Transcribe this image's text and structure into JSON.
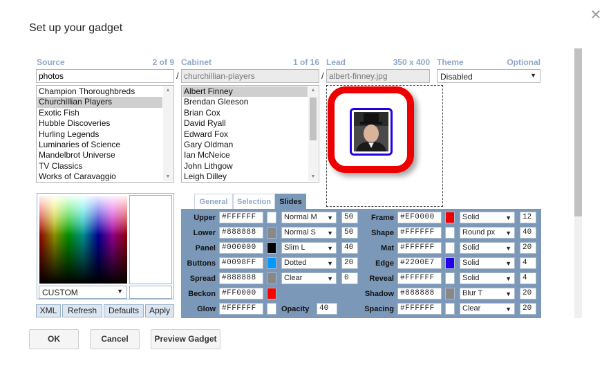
{
  "dialog": {
    "title": "Set up your gadget",
    "close_glyph": "✕"
  },
  "source": {
    "heading": "Source",
    "count": "2 of 9",
    "input_value": "photos",
    "items": [
      "Champion Thoroughbreds",
      "Churchillian Players",
      "Exotic Fish",
      "Hubble Discoveries",
      "Hurling Legends",
      "Luminaries of Science",
      "Mandelbrot Universe",
      "TV Classics",
      "Works of Caravaggio"
    ],
    "selected_index": 1
  },
  "cabinet": {
    "heading": "Cabinet",
    "count": "1 of 16",
    "input_value": "churchillian-players",
    "items": [
      "Albert Finney",
      "Brendan Gleeson",
      "Brian Cox",
      "David Ryall",
      "Edward Fox",
      "Gary Oldman",
      "Ian McNeice",
      "John Lithgow",
      "Leigh Dilley"
    ],
    "selected_index": 0
  },
  "lead": {
    "heading": "Lead",
    "size": "350 x 400",
    "input_value": "albert-finney.jpg"
  },
  "theme": {
    "heading": "Theme",
    "hint": "Optional",
    "selected": "Disabled"
  },
  "separators": {
    "slash": "/"
  },
  "color_picker": {
    "mode": "CUSTOM"
  },
  "action_buttons": {
    "xml": "XML",
    "refresh": "Refresh",
    "defaults": "Defaults",
    "apply": "Apply"
  },
  "tabs": [
    {
      "label": "General",
      "active": false
    },
    {
      "label": "Selection",
      "active": false
    },
    {
      "label": "Slides",
      "active": true
    }
  ],
  "settings_left": [
    {
      "label": "Upper",
      "hex": "#FFFFFF",
      "swatch": "#FFFFFF",
      "select": "Normal M",
      "num": "50"
    },
    {
      "label": "Lower",
      "hex": "#888888",
      "swatch": "#888888",
      "select": "Normal S",
      "num": "50"
    },
    {
      "label": "Panel",
      "hex": "#000000",
      "swatch": "#000000",
      "select": "Slim L",
      "num": "40"
    },
    {
      "label": "Buttons",
      "hex": "#0098FF",
      "swatch": "#0098FF",
      "select": "Dotted",
      "num": "20"
    },
    {
      "label": "Spread",
      "hex": "#888888",
      "swatch": "#888888",
      "select": "Clear",
      "num": "0"
    },
    {
      "label": "Beckon",
      "hex": "#FF0000",
      "swatch": "#FF0000"
    },
    {
      "label": "Glow",
      "hex": "#FFFFFF",
      "swatch": "#FFFFFF",
      "extra_label": "Opacity",
      "num": "40"
    }
  ],
  "settings_right": [
    {
      "label": "Frame",
      "hex": "#EF0000",
      "swatch": "#EF0000",
      "select": "Solid",
      "num": "12"
    },
    {
      "label": "Shape",
      "hex": "#FFFFFF",
      "swatch": "#FFFFFF",
      "select": "Round px",
      "num": "40"
    },
    {
      "label": "Mat",
      "hex": "#FFFFFF",
      "swatch": "#FFFFFF",
      "select": "Solid",
      "num": "20"
    },
    {
      "label": "Edge",
      "hex": "#2200E7",
      "swatch": "#2200E7",
      "select": "Solid",
      "num": "4"
    },
    {
      "label": "Reveal",
      "hex": "#FFFFFF",
      "swatch": "#FFFFFF",
      "select": "Solid",
      "num": "4"
    },
    {
      "label": "Shadow",
      "hex": "#888888",
      "swatch": "#888888",
      "select": "Blur T",
      "num": "20"
    },
    {
      "label": "Spacing",
      "hex": "#FFFFFF",
      "swatch": "#FFFFFF",
      "select": "Clear",
      "num": "20"
    }
  ],
  "footer": {
    "ok": "OK",
    "cancel": "Cancel",
    "preview": "Preview Gadget"
  },
  "icons": {
    "dropdown": "chevron-down-icon",
    "close": "close-icon"
  }
}
